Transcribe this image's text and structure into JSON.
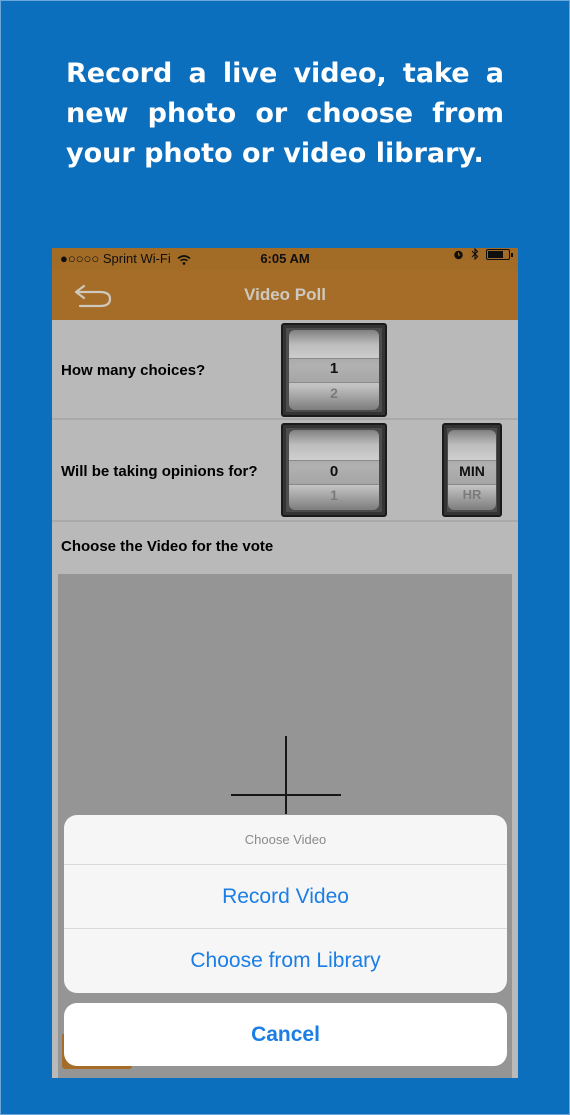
{
  "promo": {
    "headline": "Record a live video, take a new photo or choose from your photo or video library."
  },
  "status_bar": {
    "carrier": "●○○○○ Sprint Wi-Fi",
    "time": "6:05 AM"
  },
  "nav": {
    "title": "Video Poll",
    "back_icon": "back-arrow-icon"
  },
  "form": {
    "choices_label": "How many choices?",
    "choices_picker": {
      "selected": "1",
      "next": "2"
    },
    "duration_label": "Will be taking opinions for?",
    "duration_picker": {
      "selected": "0",
      "next": "1"
    },
    "unit_picker": {
      "selected": "MIN",
      "next": "HR"
    },
    "video_label": "Choose the Video for the vote"
  },
  "action_sheet": {
    "title": "Choose Video",
    "record": "Record Video",
    "library": "Choose from Library",
    "cancel": "Cancel"
  },
  "colors": {
    "background": "#0b6fbe",
    "nav_bar": "#b87a2d",
    "action_text": "#1a7ee6"
  }
}
